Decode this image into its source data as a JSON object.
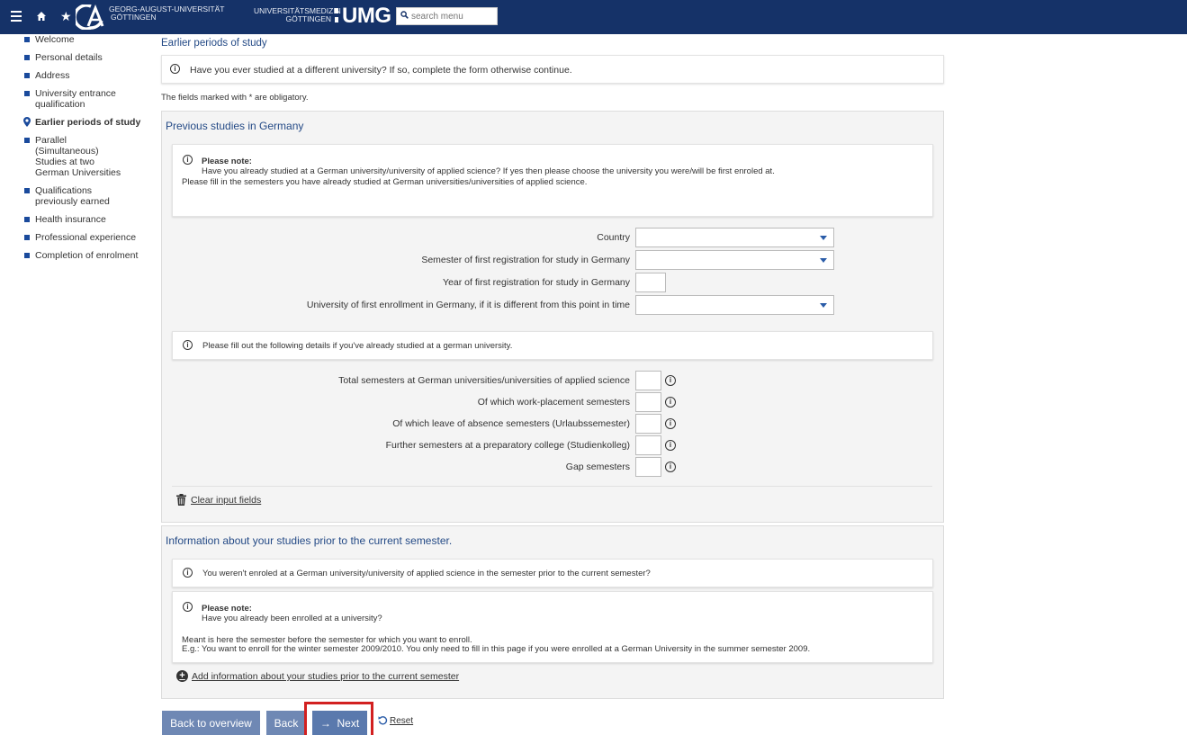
{
  "header": {
    "uni_line1": "GEORG-AUGUST-UNIVERSITÄT",
    "uni_line2": "GÖTTINGEN",
    "umg_line1": "UNIVERSITÄTSMEDIZIN",
    "umg_line2": "GÖTTINGEN",
    "umg_logo": "UMG",
    "search_placeholder": "search menu",
    "colors": {
      "bar": "#153268"
    }
  },
  "sidebar": {
    "items": [
      {
        "label": "Welcome"
      },
      {
        "label": "Personal details"
      },
      {
        "label": "Address"
      },
      {
        "label": "University entrance qualification"
      },
      {
        "label": "Earlier periods of study",
        "active": true
      },
      {
        "label": "Parallel (Simultaneous) Studies at two German Universities"
      },
      {
        "label": "Qualifications previously earned"
      },
      {
        "label": "Health insurance"
      },
      {
        "label": "Professional experience"
      },
      {
        "label": "Completion of enrolment"
      }
    ]
  },
  "main": {
    "title": "Earlier periods of study",
    "intro": "Have you ever studied at a different university? If so, complete the form otherwise continue.",
    "obligatory_note": "The fields marked with * are obligatory.",
    "section1": {
      "title": "Previous studies in Germany",
      "note_heading": "Please note:",
      "note_line1": "Have you already studied at a German university/university of applied science? If yes then please choose the university you were/will be first enroled at.",
      "note_line2": "Please fill in the semesters you have already studied at German universities/universities of applied science.",
      "fields": {
        "country": "Country",
        "semester_first": "Semester of first registration for study in Germany",
        "year_first": "Year of first registration for study in Germany",
        "university_first": "University of first enrollment in Germany, if it is different from this point in time"
      },
      "details_note": "Please fill out the following details if you've already studied at a german university.",
      "semester_fields": {
        "total": "Total semesters at German universities/universities of applied science",
        "work_placement": "Of which work-placement semesters",
        "leave_absence": "Of which leave of absence semesters (Urlaubssemester)",
        "preparatory": "Further semesters at a preparatory college (Studienkolleg)",
        "gap": "Gap semesters"
      },
      "clear_label": "Clear input fields"
    },
    "section2": {
      "title": "Information about your studies prior to the current semester.",
      "info_line": "You weren't enroled at a German university/university of applied science in the semester prior to the current semester?",
      "note_heading": "Please note:",
      "note_line1": "Have you already been enrolled at a university?",
      "note_line2": "Meant is here the semester before the semester for which you want to enroll.",
      "note_line3": "E.g.: You want to enroll for the winter semester 2009/2010. You only need to fill in this page if you were enrolled at a German University in the summer semester 2009.",
      "add_label": "Add information about your studies prior to the current semester"
    }
  },
  "buttons": {
    "overview": "Back to overview",
    "back": "Back",
    "next": "Next",
    "reset": "Reset",
    "next_arrow": "→"
  },
  "icons": {
    "info": "i",
    "star": "★"
  }
}
